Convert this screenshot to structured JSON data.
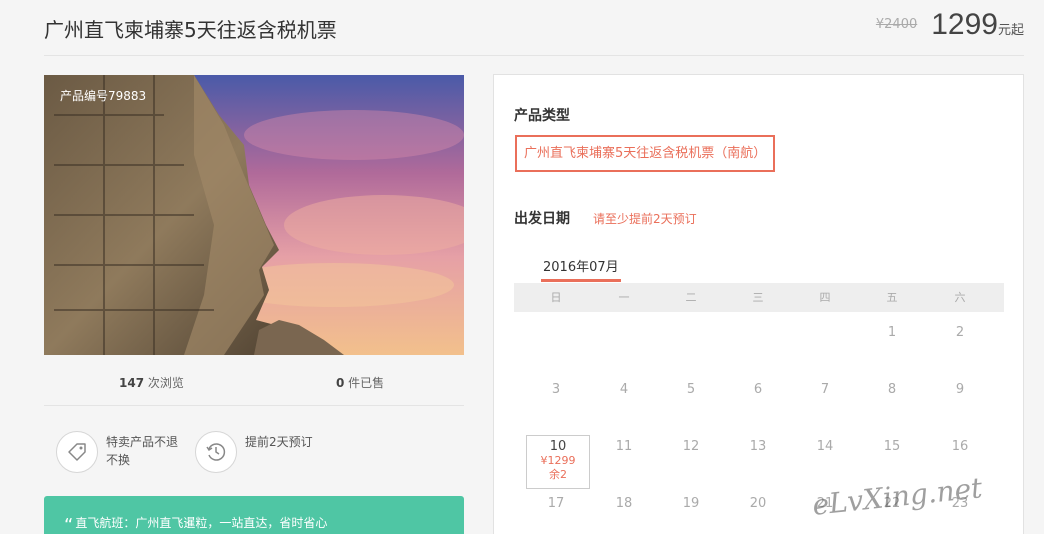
{
  "header": {
    "title": "广州直飞柬埔寨5天往返含税机票",
    "original_price": "¥2400",
    "price": "1299",
    "price_unit": "元起"
  },
  "gallery": {
    "product_no": "产品编号79883",
    "image": "temple-face-sunset"
  },
  "stats": {
    "views_count": "147",
    "views_label": " 次浏览",
    "sold_count": "0",
    "sold_label": " 件已售"
  },
  "features": [
    {
      "icon": "tag-icon",
      "text": "特卖产品不退不换"
    },
    {
      "icon": "clock-icon",
      "text": "提前2天预订"
    }
  ],
  "quote": {
    "mark": "“",
    "text": "直飞航班：广州直飞暹粒，一站直达，省时省心"
  },
  "booking": {
    "type_label": "产品类型",
    "product_type": "广州直飞柬埔寨5天往返含税机票（南航）",
    "date_label": "出发日期",
    "date_hint": "请至少提前2天预订",
    "month": "2016年07月",
    "weekdays": [
      "日",
      "一",
      "二",
      "三",
      "四",
      "五",
      "六"
    ],
    "weeks": [
      [
        "",
        "",
        "",
        "",
        "",
        "1",
        "2"
      ],
      [
        "3",
        "4",
        "5",
        "6",
        "7",
        "8",
        "9"
      ],
      [
        "10",
        "11",
        "12",
        "13",
        "14",
        "15",
        "16"
      ],
      [
        "17",
        "18",
        "19",
        "20",
        "21",
        "22",
        "23"
      ]
    ],
    "selected": {
      "day": "10",
      "price": "¥1299",
      "remaining": "余2"
    }
  },
  "watermark": "eLvXing.net",
  "colors": {
    "accent": "#ea6f5a",
    "quote_bg": "#4fc6a4"
  }
}
